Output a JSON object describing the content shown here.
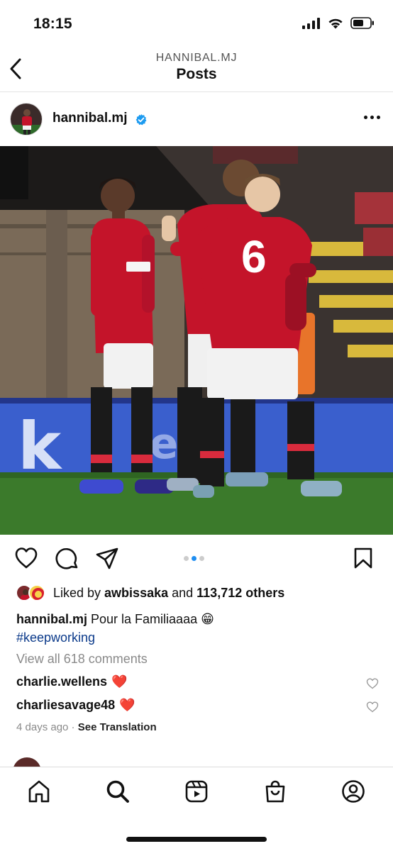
{
  "status_bar": {
    "time": "18:15"
  },
  "header": {
    "subtitle": "HANNIBAL.MJ",
    "title": "Posts"
  },
  "post": {
    "username": "hannibal.mj",
    "carousel": {
      "count": 3,
      "active_index": 1
    },
    "likes": {
      "prefix": "Liked by ",
      "liker": "awbissaka",
      "middle": " and ",
      "count": "113,712 others"
    },
    "caption": {
      "username": "hannibal.mj",
      "text": " Pour la Familiaaaa 😁",
      "hashtag": "#keepworking"
    },
    "view_comments": "View all 618 comments",
    "comments": [
      {
        "user": "charlie.wellens",
        "emoji": "❤️"
      },
      {
        "user": "charliesavage48",
        "emoji": "❤️"
      }
    ],
    "time_ago": "4 days ago",
    "separator": " · ",
    "see_translation": "See Translation"
  },
  "icons": {
    "status": [
      "signal-icon",
      "wifi-icon",
      "battery-icon"
    ],
    "actions": [
      "heart-icon",
      "comment-icon",
      "share-icon",
      "bookmark-icon"
    ],
    "tabs": [
      "home-icon",
      "search-icon",
      "reels-icon",
      "shop-icon",
      "profile-icon"
    ]
  },
  "colors": {
    "verified": "#1d9bf0",
    "hashtag": "#0b3a8a",
    "carousel_active": "#1f8ef1",
    "jersey_red": "#c4142a",
    "pitch_green": "#3b7a2b",
    "board_blue": "#3a5fcd"
  }
}
